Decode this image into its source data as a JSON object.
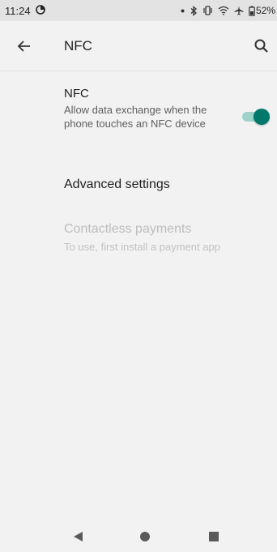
{
  "status_bar": {
    "time": "11:24",
    "battery": "52%",
    "icons": [
      "data-saver-icon",
      "dot-icon",
      "bluetooth-icon",
      "vibrate-icon",
      "wifi-icon",
      "airplane-icon",
      "battery-icon"
    ]
  },
  "app_bar": {
    "title": "NFC",
    "back_icon": "arrow-back-icon",
    "search_icon": "search-icon"
  },
  "preferences": {
    "nfc": {
      "title": "NFC",
      "summary": "Allow data exchange when the phone touches an NFC device",
      "enabled": true
    },
    "advanced": {
      "title": "Advanced settings"
    },
    "contactless": {
      "title": "Contactless payments",
      "summary": "To use, first install a payment app",
      "enabled": false
    }
  },
  "nav_bar": {
    "icons": [
      "nav-back-icon",
      "nav-home-icon",
      "nav-recents-icon"
    ]
  },
  "colors": {
    "accent": "#00796b",
    "accent_track": "#9fd3c9",
    "status_bar_bg": "#e3e3e3",
    "background": "#f2f2f2",
    "disabled_text": "#bdbdbd"
  }
}
